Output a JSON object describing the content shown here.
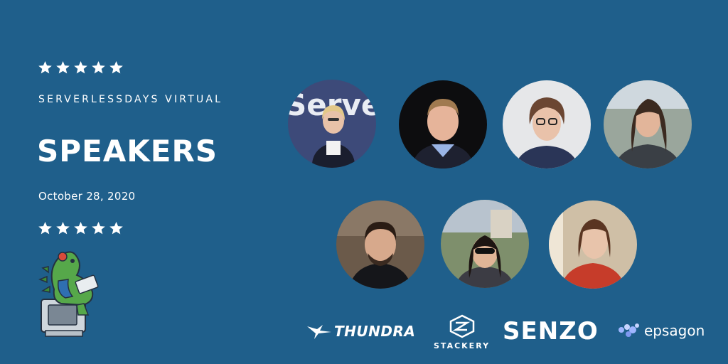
{
  "event": {
    "subtitle": "SERVERLESSDAYS VIRTUAL",
    "title": "SPEAKERS",
    "date": "October 28, 2020",
    "stars_count": 5
  },
  "colors": {
    "background": "#1f5f8b",
    "text": "#ffffff"
  },
  "speakers": [
    {
      "photo": "speaker-photo-1"
    },
    {
      "photo": "speaker-photo-2"
    },
    {
      "photo": "speaker-photo-3"
    },
    {
      "photo": "speaker-photo-4"
    },
    {
      "photo": "speaker-photo-5"
    },
    {
      "photo": "speaker-photo-6"
    },
    {
      "photo": "speaker-photo-7"
    }
  ],
  "photo1_sign_text": "Serve",
  "sponsors": {
    "thundra": "THUNDRA",
    "stackery": "STACKERY",
    "senzo": "SENZO",
    "epsagon": "epsagon"
  },
  "mascot_icon": "dinosaur-mascot-icon"
}
